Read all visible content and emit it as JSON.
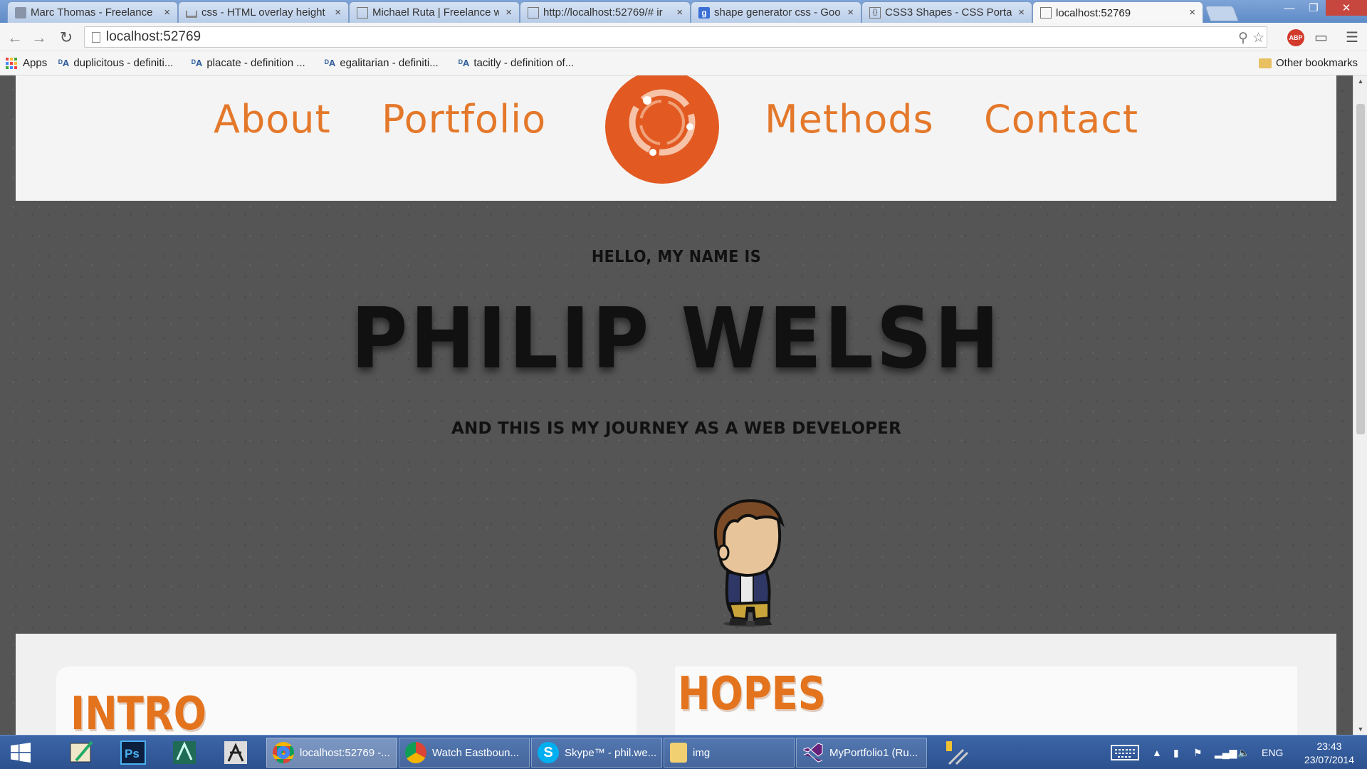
{
  "browser": {
    "tabs": [
      {
        "label": "Marc Thomas - Freelance",
        "icon": "site-icon",
        "active": false
      },
      {
        "label": "css - HTML overlay height",
        "icon": "stackoverflow-icon",
        "active": false
      },
      {
        "label": "Michael Ruta | Freelance w",
        "icon": "page-icon",
        "active": false
      },
      {
        "label": "http://localhost:52769/# ir",
        "icon": "page-icon",
        "active": false
      },
      {
        "label": "shape generator css - Goo",
        "icon": "google-icon",
        "active": false
      },
      {
        "label": "CSS3 Shapes - CSS Portal",
        "icon": "css-portal-icon",
        "active": false
      },
      {
        "label": "localhost:52769",
        "icon": "page-icon",
        "active": true
      }
    ],
    "tab_close": "×",
    "url": "localhost:52769",
    "bookmarks": {
      "apps": "Apps",
      "items": [
        "duplicitous - definiti...",
        "placate - definition ...",
        "egalitarian - definiti...",
        "tacitly - definition of..."
      ],
      "other": "Other bookmarks"
    }
  },
  "site": {
    "nav": {
      "about": "About",
      "portfolio": "Portfolio",
      "methods": "Methods",
      "contact": "Contact"
    },
    "hero": {
      "hello": "HELLO, MY NAME IS",
      "name": "PHILIP WELSH",
      "subtitle": "AND THIS IS MY JOURNEY AS A WEB DEVELOPER"
    },
    "sections": {
      "intro_title": "INTRO",
      "hopes_title": "HOPES"
    },
    "colors": {
      "accent": "#e4782a",
      "logo": "#e25a22",
      "hero_bg": "#555555",
      "header_bg": "#f4f4f4"
    }
  },
  "taskbar": {
    "tasks": [
      {
        "label": "localhost:52769 -...",
        "icon": "chrome-icon",
        "active": true
      },
      {
        "label": "Watch Eastboun...",
        "icon": "chrome-icon",
        "active": false
      },
      {
        "label": "Skype™ - phil.we...",
        "icon": "skype-icon",
        "active": false
      },
      {
        "label": "img",
        "icon": "folder-icon",
        "active": false
      },
      {
        "label": "MyPortfolio1 (Ru...",
        "icon": "visual-studio-icon",
        "active": false
      }
    ],
    "language": "ENG",
    "time": "23:43",
    "date": "23/07/2014"
  }
}
